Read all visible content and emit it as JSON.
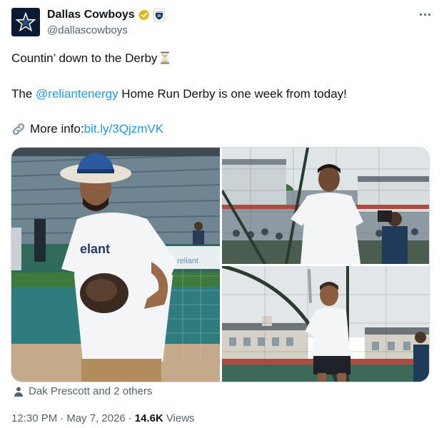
{
  "author": {
    "display_name": "Dallas Cowboys",
    "handle": "@dallascowboys",
    "avatar_icon": "cowboys-star-icon",
    "verified_icon": "gold-verified-badge-icon",
    "affiliate_icon": "nfl-shield-icon"
  },
  "tweet": {
    "line1": "Countin’ down to the Derby",
    "line1_emoji": "hourglass-icon",
    "line2_prefix": "The ",
    "line2_mention": "@reliantenergy",
    "line2_suffix": " Home Run Derby is one week from today!",
    "line3_label": "More info: ",
    "line3_link": "bit.ly/3QjzmVK",
    "line3_icon": "link-icon"
  },
  "media": {
    "photo_left_logo": "elant",
    "photo_left_banner": "reliant"
  },
  "tagged": {
    "text": "Dak Prescott and 2 others",
    "icon": "person-icon"
  },
  "meta": {
    "time": "12:30 PM",
    "separator": "·",
    "date": "May 7, 2026",
    "views_count": "14.6K",
    "views_label": "Views"
  },
  "colors": {
    "link": "#1d9bf0",
    "secondary_text": "#536471",
    "primary_text": "#0f1419",
    "verified_gold": "#e2b719"
  }
}
